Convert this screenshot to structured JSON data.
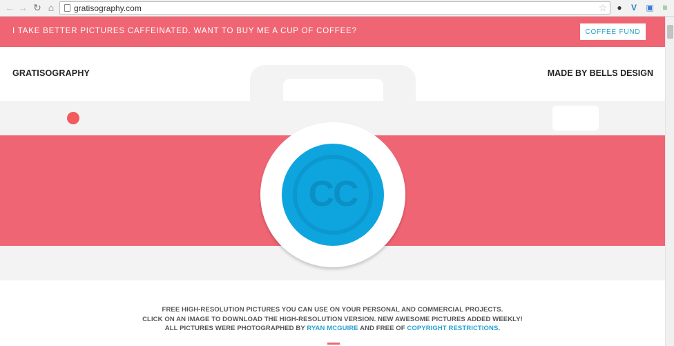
{
  "browser": {
    "url": "gratisography.com",
    "nav": {
      "back_icon": "arrow-left",
      "forward_icon": "arrow-right",
      "reload_icon": "reload",
      "home_icon": "home"
    }
  },
  "promo": {
    "text": "I TAKE BETTER PICTURES CAFFEINATED. WANT TO BUY ME A CUP OF COFFEE?",
    "button": "COFFEE FUND"
  },
  "header": {
    "brand": "GRATISOGRAPHY",
    "made_by": "MADE BY BELLS DESIGN"
  },
  "hero": {
    "lens_label": "CC"
  },
  "info": {
    "line1": "FREE HIGH-RESOLUTION PICTURES YOU CAN USE ON YOUR PERSONAL AND COMMERCIAL PROJECTS.",
    "line2": "CLICK ON AN IMAGE TO DOWNLOAD THE HIGH-RESOLUTION VERSION. NEW AWESOME PICTURES ADDED WEEKLY!",
    "line3_prefix": "ALL PICTURES WERE PHOTOGRAPHED BY",
    "line3_author": "RYAN MCGUIRE",
    "line3_middle": "AND FREE OF",
    "line3_link": "COPYRIGHT RESTRICTIONS",
    "line3_suffix": "."
  },
  "colors": {
    "accent_pink": "#f06574",
    "link_blue": "#27a1cf",
    "lens_blue": "#0ea5df"
  }
}
